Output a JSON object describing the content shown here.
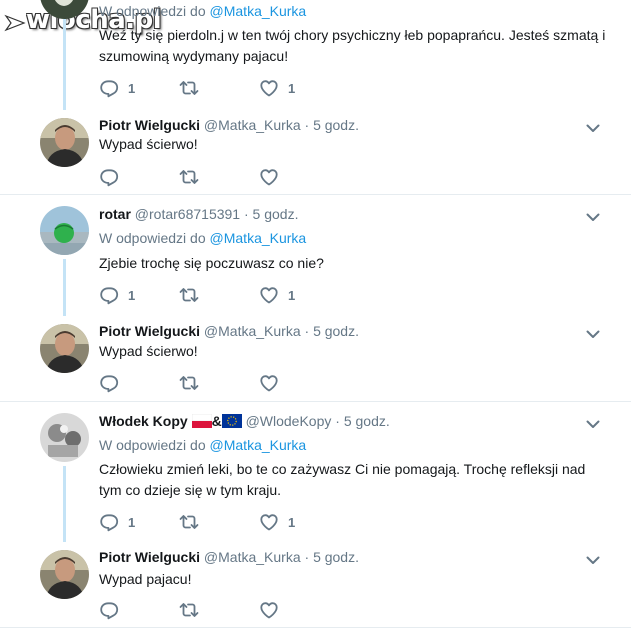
{
  "colors": {
    "link": "#1b95e0",
    "muted": "#657786",
    "thread_line": "#c4e3f6",
    "divider": "#e6ecf0",
    "text": "#14171a"
  },
  "watermark": {
    "text": "wiocha.pl"
  },
  "tweets": [
    {
      "reply_label": "W odpowiedzi do",
      "reply_handle": "@Matka_Kurka",
      "text": "Weź ty się pierdoln.j w ten twój chory psychiczny łeb popaprańcu. Jesteś szmatą i szumowiną wydymany pajacu!",
      "reply_count": "1",
      "retweet_count": "",
      "like_count": "1"
    },
    {
      "name": "Piotr Wielgucki",
      "handle": "@Matka_Kurka",
      "time": "5 godz.",
      "text": "Wypad ścierwo!",
      "reply_count": "",
      "retweet_count": "",
      "like_count": ""
    },
    {
      "name": "rotar",
      "handle": "@rotar68715391",
      "time": "5 godz.",
      "reply_label": "W odpowiedzi do",
      "reply_handle": "@Matka_Kurka",
      "text": "Zjebie trochę się poczuwasz co nie?",
      "reply_count": "1",
      "retweet_count": "",
      "like_count": "1"
    },
    {
      "name": "Piotr Wielgucki",
      "handle": "@Matka_Kurka",
      "time": "5 godz.",
      "text": "Wypad ścierwo!",
      "reply_count": "",
      "retweet_count": "",
      "like_count": ""
    },
    {
      "name": "Włodek Kopy",
      "flag_sep": "&",
      "handle": "@WlodeKopy",
      "time": "5 godz.",
      "reply_label": "W odpowiedzi do",
      "reply_handle": "@Matka_Kurka",
      "text": "Człowieku zmień leki, bo te co zażywasz Ci nie pomagają. Trochę refleksji nad tym co dzieje się w tym kraju.",
      "reply_count": "1",
      "retweet_count": "",
      "like_count": "1"
    },
    {
      "name": "Piotr Wielgucki",
      "handle": "@Matka_Kurka",
      "time": "5 godz.",
      "text": "Wypad pajacu!",
      "reply_count": "",
      "retweet_count": "",
      "like_count": ""
    }
  ],
  "separator": "·",
  "icons": [
    "reply-icon",
    "retweet-icon",
    "like-icon",
    "caret-down-icon"
  ]
}
